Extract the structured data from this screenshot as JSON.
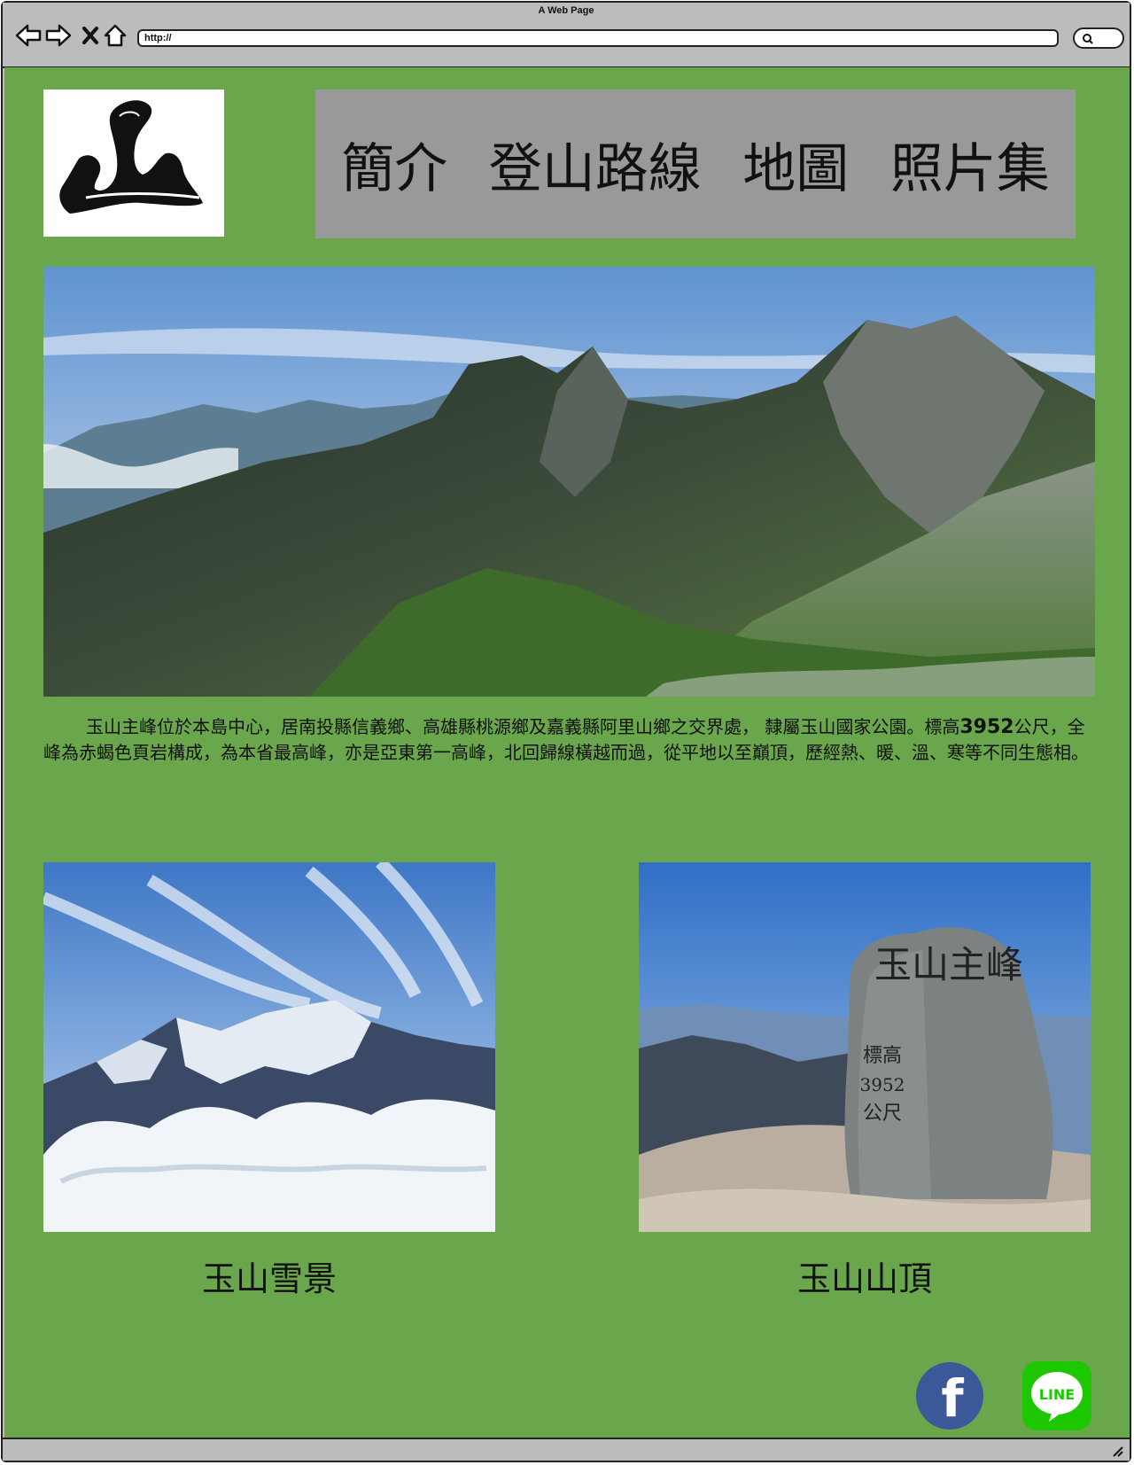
{
  "browser": {
    "window_title": "A Web Page",
    "url": "http://"
  },
  "nav": {
    "items": [
      {
        "label": "簡介"
      },
      {
        "label": "登山路線"
      },
      {
        "label": "地圖"
      },
      {
        "label": "照片集"
      }
    ]
  },
  "intro": {
    "part1": "玉山主峰位於本島中心，居南投縣信義鄉、高雄縣桃源鄉及嘉義縣阿里山鄉之交界處， 隸屬玉山國家公園。標高",
    "height": "3952",
    "part2": "公尺，全峰為赤蝎色頁岩構成，為本省最高峰，亦是亞東第一高峰，北回歸線橫越而過，從平地以至巔頂，歷經熱、暖、溫、寒等不同生態相。"
  },
  "gallery": [
    {
      "caption": "玉山雪景"
    },
    {
      "caption": "玉山山頂"
    }
  ],
  "summit_stone": {
    "inscription": "玉山主峰",
    "elevation": "標高",
    "elevation_value": "3952",
    "unit": "公尺"
  },
  "social": {
    "facebook": "f",
    "line": "LINE"
  },
  "colors": {
    "page_bg": "#6aa64b",
    "nav_bg": "#999999",
    "frame": "#bcbcbc",
    "facebook": "#3b5998",
    "line": "#1ec800"
  }
}
